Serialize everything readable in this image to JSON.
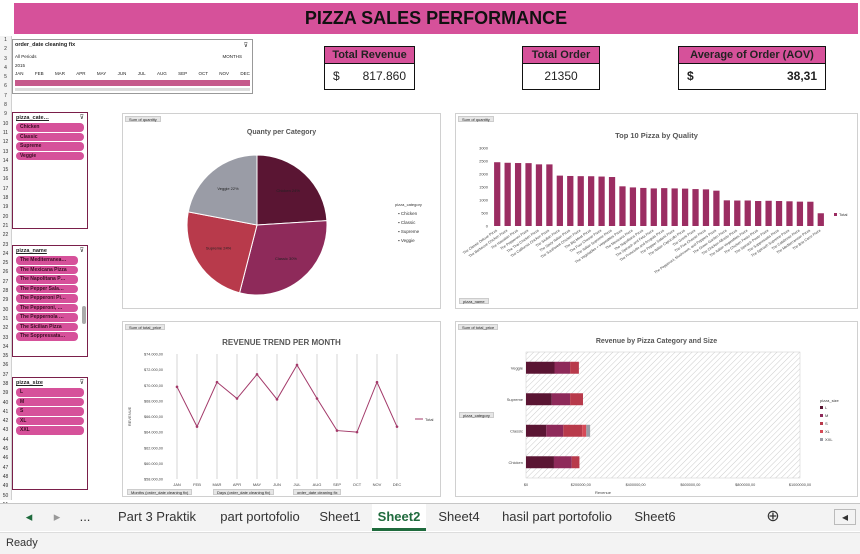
{
  "title": "PIZZA SALES PERFORMANCE",
  "kpis": {
    "revenue": {
      "label": "Total Revenue",
      "currency": "$",
      "value": "817.860"
    },
    "orders": {
      "label": "Total Order",
      "value": "21350"
    },
    "aov": {
      "label": "Average of Order (AOV)",
      "currency": "$",
      "value": "38,31"
    }
  },
  "timeline": {
    "title": "order_date cleaning fix",
    "filter": "All Periods",
    "unit": "MONTHS",
    "year": "2015",
    "months": [
      "JAN",
      "FEB",
      "MAR",
      "APR",
      "MAY",
      "JUN",
      "JUL",
      "AUG",
      "SEP",
      "OCT",
      "NOV",
      "DEC"
    ]
  },
  "slicers": {
    "category": {
      "title": "pizza_cate…",
      "items": [
        "Chicken",
        "Classic",
        "Supreme",
        "Veggie"
      ]
    },
    "name": {
      "title": "pizza_name",
      "items": [
        "The Mediterranea…",
        "The Mexicana Pizza",
        "The Napolitana P…",
        "The Pepper Sala…",
        "The Pepperoni Pi…",
        "The Pepperoni, …",
        "The Peppernola …",
        "The Sicilian Pizza",
        "The Soppressata…"
      ]
    },
    "size": {
      "title": "pizza_size",
      "items": [
        "L",
        "M",
        "S",
        "XL",
        "XXL"
      ]
    }
  },
  "chart_data": [
    {
      "type": "pie",
      "tag": "Sum of quantity",
      "title": "Quanty per Category",
      "categories": [
        "Chicken",
        "Classic",
        "Supreme",
        "Veggie"
      ],
      "values": [
        24,
        30,
        24,
        22
      ],
      "slice_labels": [
        "Chicken 24%",
        "Classic 30%",
        "Supreme 24%",
        "Veggie 22%"
      ],
      "colors": [
        "#5a1533",
        "#8e2a5a",
        "#b83a4b",
        "#9a9ca6"
      ],
      "legend_title": "pizza_category"
    },
    {
      "type": "bar",
      "tag": "Sum of quantity",
      "title": "Top 10 Pizza by Quality",
      "legend": "Total",
      "field_button": "pizza_name",
      "ylim": [
        0,
        3000
      ],
      "yticks": [
        "0",
        "500",
        "1000",
        "1500",
        "2000",
        "2500",
        "3000"
      ],
      "categories": [
        "The Classic Deluxe Pizza",
        "The Barbecue Chicken Pizza",
        "The Hawaiian Pizza",
        "The Pepperoni Pizza",
        "The Thai Chicken Pizza",
        "The California Chicken Pizza",
        "The Sicilian Pizza",
        "The Spicy Italian Pizza",
        "The Southwest Chicken Pizza",
        "The Big Meat Pizza",
        "The Four Cheese Pizza",
        "The Italian Supreme Pizza",
        "The Vegetables + Vegetables Pizza",
        "The Mexicana Pizza",
        "The Napolitana Pizza",
        "The Spinach and Feta Pizza",
        "The Prosciutto and Arugula Pizza",
        "The Pepper Salami Pizza",
        "The Italian Capocollo Pizza",
        "The Greek Pizza",
        "The Five Cheese Pizza",
        "The Pepperoni, Mushroom, and Peppers Pizza",
        "The Green Garden Pizza",
        "The Chicken Alfredo Pizza",
        "The Italian Vegetables Pizza",
        "The Chicken Pesto Pizza",
        "The Spinach Pesto Pizza",
        "The Soppressata Pizza",
        "The Spinach Supreme Pizza",
        "The Calabrese Pizza",
        "The Mediterranean Pizza",
        "The Brie Carre Pizza"
      ],
      "values": [
        2453,
        2432,
        2422,
        2418,
        2371,
        2370,
        1938,
        1924,
        1917,
        1914,
        1902,
        1884,
        1526,
        1484,
        1464,
        1446,
        1457,
        1446,
        1438,
        1420,
        1409,
        1359,
        987,
        980,
        981,
        961,
        970,
        961,
        950,
        937,
        934,
        490
      ]
    },
    {
      "type": "line",
      "tag": "Sum of total_price",
      "title": "REVENUE TREND PER MONTH",
      "ylabel": "REVENUE",
      "legend": "Total",
      "ylim": [
        58000,
        74000
      ],
      "yticks": [
        "$58.000,00",
        "$60.000,00",
        "$62.000,00",
        "$64.000,00",
        "$66.000,00",
        "$68.000,00",
        "$70.000,00",
        "$72.000,00",
        "$74.000,00"
      ],
      "categories": [
        "JAN",
        "FEB",
        "MAR",
        "APR",
        "MAY",
        "JUN",
        "JUL",
        "AUG",
        "SEP",
        "OCT",
        "NOV",
        "DEC"
      ],
      "values": [
        69800,
        64700,
        70400,
        68300,
        71400,
        68200,
        72600,
        68300,
        64200,
        64000,
        70400,
        64700
      ],
      "field_buttons": [
        "Months (order_date cleaning fix)",
        "Days (order_date cleaning fix)",
        "order_date cleaning fix"
      ]
    },
    {
      "type": "bar",
      "orientation": "horizontal",
      "stacked": true,
      "tag": "Sum of total_price",
      "title": "Revenue by Pizza Category and Size",
      "xlabel": "Revenue",
      "xlim": [
        0,
        1000000
      ],
      "xticks": [
        "$0",
        "$200000,00",
        "$400000,00",
        "$600000,00",
        "$800000,00",
        "$1000000,00"
      ],
      "field_button": "pizza_category",
      "legend_title": "pizza_size",
      "categories": [
        "Veggie",
        "Supreme",
        "Classic",
        "Chicken"
      ],
      "series": [
        {
          "name": "L",
          "color": "#5a1533",
          "values": [
            104000,
            94000,
            74000,
            102000
          ]
        },
        {
          "name": "M",
          "color": "#8e2a5a",
          "values": [
            57000,
            67000,
            62000,
            65000
          ]
        },
        {
          "name": "S",
          "color": "#b83a4b",
          "values": [
            32000,
            47000,
            69000,
            28000
          ]
        },
        {
          "name": "XL",
          "color": "#d64a57",
          "values": [
            0,
            0,
            15000,
            0
          ]
        },
        {
          "name": "XXL",
          "color": "#9a9ca6",
          "values": [
            0,
            0,
            14000,
            0
          ]
        }
      ]
    }
  ],
  "sheet_tabs": [
    "Part 3 Praktik",
    "part portofolio",
    "Sheet1",
    "Sheet2",
    "Sheet4",
    "hasil part portofolio",
    "Sheet6"
  ],
  "active_tab": "Sheet2",
  "tab_nav": {
    "ellipsis": "...",
    "add": "⊕",
    "prev": "◂",
    "next": "▸"
  },
  "status": "Ready"
}
